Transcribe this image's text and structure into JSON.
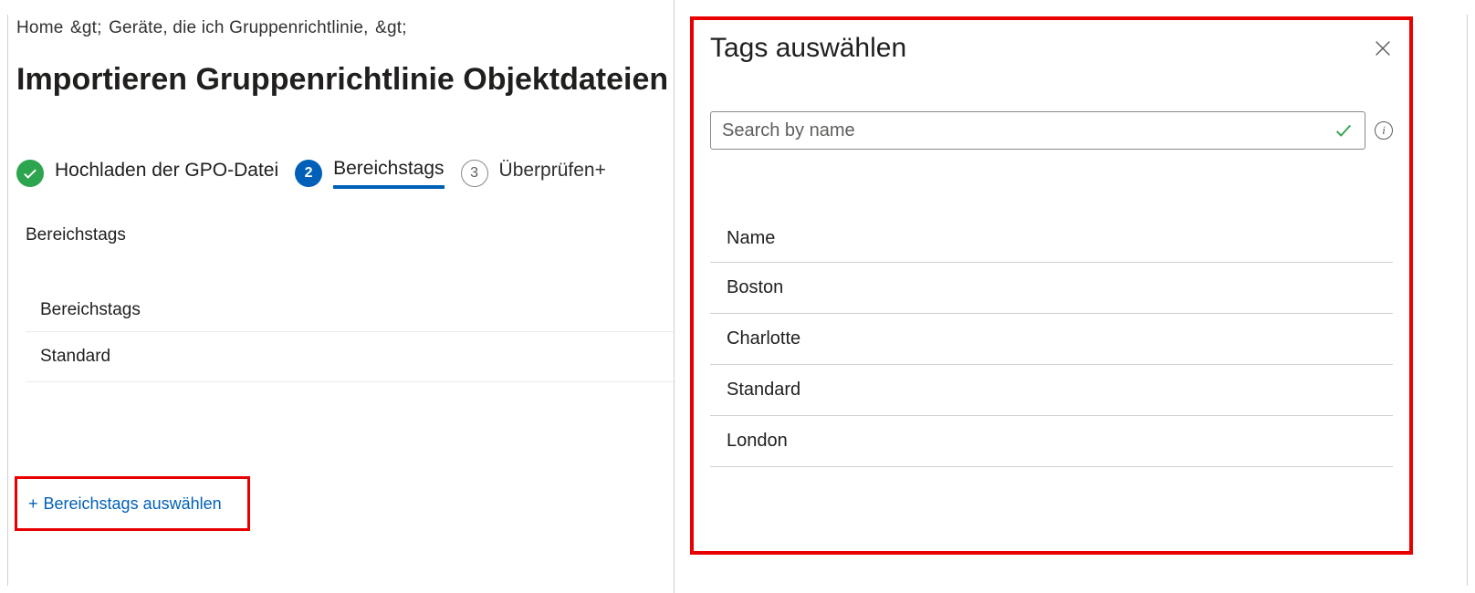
{
  "breadcrumb": {
    "items": [
      "Home",
      "Geräte, die ich Gruppenrichtlinie,"
    ],
    "sep": "&gt;"
  },
  "page_title": "Importieren Gruppenrichtlinie Objektdateien",
  "stepper": {
    "step1": {
      "label": "Hochladen der GPO-Datei"
    },
    "step2": {
      "label": "Bereichstags",
      "num": "2"
    },
    "step3": {
      "label": "Überprüfen+",
      "num": "3"
    }
  },
  "left": {
    "section_label": "Bereichstags",
    "list_header": "Bereichstags",
    "rows": [
      "Standard"
    ],
    "select_link": "Bereichstags auswählen"
  },
  "right": {
    "title": "Tags auswählen",
    "search_placeholder": "Search by name",
    "info_char": "i",
    "col_header": "Name",
    "items": [
      "Boston",
      "Charlotte",
      "Standard",
      "London"
    ]
  }
}
